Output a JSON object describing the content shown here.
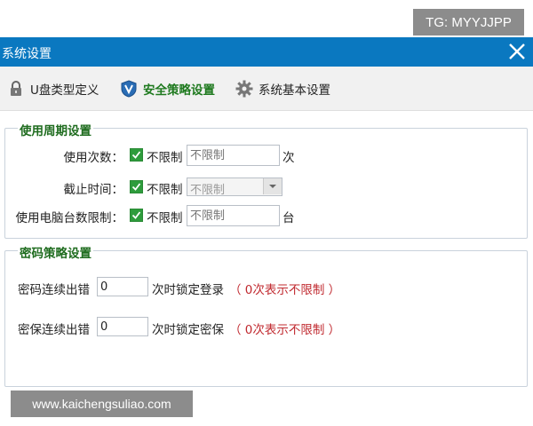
{
  "watermark_top": "TG: MYYJJPP",
  "watermark_bottom": "www.kaichengsuliao.com",
  "window": {
    "title": "系统设置"
  },
  "toolbar": {
    "items": [
      {
        "label": "U盘类型定义",
        "icon": "lock-icon"
      },
      {
        "label": "安全策略设置",
        "icon": "shield-icon",
        "active": true
      },
      {
        "label": "系统基本设置",
        "icon": "gear-icon"
      }
    ]
  },
  "usage_period": {
    "legend": "使用周期设置",
    "rows": [
      {
        "label": "使用次数：",
        "checkbox_label": "不限制",
        "checked": true,
        "input_placeholder": "不限制",
        "unit": "次"
      },
      {
        "label": "截止时间：",
        "checkbox_label": "不限制",
        "checked": true,
        "select_value": "不限制"
      },
      {
        "label": "使用电脑台数限制：",
        "checkbox_label": "不限制",
        "checked": true,
        "input_placeholder": "不限制",
        "unit": "台"
      }
    ]
  },
  "password_policy": {
    "legend": "密码策略设置",
    "rows": [
      {
        "label": "密码连续出错",
        "value": "0",
        "suffix": "次时锁定登录",
        "hint": "（ 0次表示不限制 ）"
      },
      {
        "label": "密保连续出错",
        "value": "0",
        "suffix": "次时锁定密保",
        "hint": "（ 0次表示不限制 ）"
      }
    ]
  },
  "colors": {
    "titlebar": "#0a78c0",
    "legend": "#1f6c1f",
    "hint": "#c0282e",
    "checkbox": "#2e9c3c"
  }
}
